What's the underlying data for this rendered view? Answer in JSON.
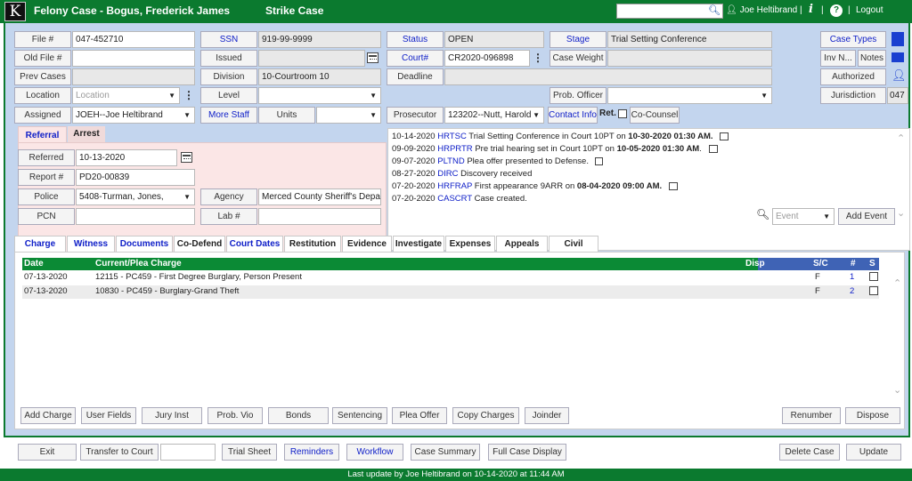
{
  "header": {
    "logo": "K",
    "title": "Felony Case - Bogus, Frederick James",
    "strike": "Strike Case",
    "user": "Joe Heltibrand |",
    "logout": "Logout"
  },
  "fields": {
    "file_label": "File #",
    "file_value": "047-452710",
    "oldfile_label": "Old File #",
    "prevcases_label": "Prev Cases",
    "location_label": "Location",
    "location_placeholder": "Location",
    "assigned_label": "Assigned",
    "assigned_value": "JOEH--Joe Heltibrand",
    "ssn_label": "SSN",
    "ssn_value": "919-99-9999",
    "issued_label": "Issued",
    "division_label": "Division",
    "division_value": "10-Courtroom 10",
    "level_label": "Level",
    "morestaff_label": "More Staff",
    "units_label": "Units",
    "status_label": "Status",
    "status_value": "OPEN",
    "court_label": "Court#",
    "court_value": "CR2020-096898",
    "deadline_label": "Deadline",
    "prosecutor_label": "Prosecutor",
    "prosecutor_value": "123202--Nutt, Harold",
    "contactinfo_label": "Contact Info",
    "ret_label": "Ret.",
    "cocounsel_label": "Co-Counsel",
    "stage_label": "Stage",
    "stage_value": "Trial Setting Conference",
    "caseweight_label": "Case Weight",
    "probofficer_label": "Prob. Officer",
    "casetypes_label": "Case Types",
    "inv_label": "Inv N...",
    "notes_label": "Notes",
    "authorized_label": "Authorized",
    "jurisdiction_label": "Jurisdiction",
    "jurisdiction_value": "047"
  },
  "referral": {
    "tab_referral": "Referral",
    "tab_arrest": "Arrest",
    "referred_label": "Referred",
    "referred_value": "10-13-2020",
    "report_label": "Report #",
    "report_value": "PD20-00839",
    "police_label": "Police",
    "police_value": "5408-Turman, Jones,",
    "pcn_label": "PCN",
    "agency_label": "Agency",
    "agency_value": "Merced County Sheriff's Depa",
    "lab_label": "Lab #"
  },
  "events": [
    {
      "date": "10-14-2020",
      "code": "HRTSC",
      "text": "Trial Setting Conference in Court 10PT on",
      "when": "10-30-2020 01:30 AM."
    },
    {
      "date": "09-09-2020",
      "code": "HRPRTR",
      "text": "Pre trial hearing set in Court 10PT on",
      "when": "10-05-2020 01:30 AM",
      "tail": "."
    },
    {
      "date": "09-07-2020",
      "code": "PLTND",
      "text": "Plea offer presented to Defense.",
      "when": ""
    },
    {
      "date": "08-27-2020",
      "code": "DIRC",
      "text": "Discovery received",
      "when": ""
    },
    {
      "date": "07-20-2020",
      "code": "HRFRAP",
      "text": "First appearance 9ARR on",
      "when": "08-04-2020 09:00 AM."
    },
    {
      "date": "07-20-2020",
      "code": "CASCRT",
      "text": "Case created.",
      "when": ""
    }
  ],
  "event_controls": {
    "event_placeholder": "Event",
    "add_event": "Add Event"
  },
  "charge_tabs": [
    "Charge",
    "Witness",
    "Documents",
    "Co-Defend",
    "Court Dates",
    "Restitution",
    "Evidence",
    "Investigate",
    "Expenses",
    "Appeals",
    "Civil"
  ],
  "charge_table": {
    "headers": {
      "date": "Date",
      "charge": "Current/Plea Charge",
      "disp": "Disp",
      "sc": "S/C",
      "num": "#",
      "s": "S"
    },
    "rows": [
      {
        "date": "07-13-2020",
        "charge": "12115 - PC459 - First Degree Burglary, Person Present",
        "sc": "F",
        "num": "1"
      },
      {
        "date": "07-13-2020",
        "charge": "10830 - PC459 - Burglary-Grand Theft",
        "sc": "F",
        "num": "2"
      }
    ]
  },
  "charge_buttons": [
    "Add Charge",
    "User Fields",
    "Jury Inst",
    "Prob. Vio",
    "Bonds",
    "Sentencing",
    "Plea Offer",
    "Copy Charges",
    "Joinder",
    "Renumber",
    "Dispose"
  ],
  "bottom_buttons": {
    "exit": "Exit",
    "transfer": "Transfer to Court",
    "trial_sheet": "Trial Sheet",
    "reminders": "Reminders",
    "workflow": "Workflow",
    "case_summary": "Case Summary",
    "full_case": "Full Case Display",
    "delete_case": "Delete Case",
    "update": "Update"
  },
  "footer": "Last update by Joe Heltibrand on 10-14-2020 at 11:44 AM",
  "colors": {
    "brand_green": "#0b7a2f",
    "panel_blue": "#c3d5ee",
    "link_blue": "#1020c8"
  }
}
